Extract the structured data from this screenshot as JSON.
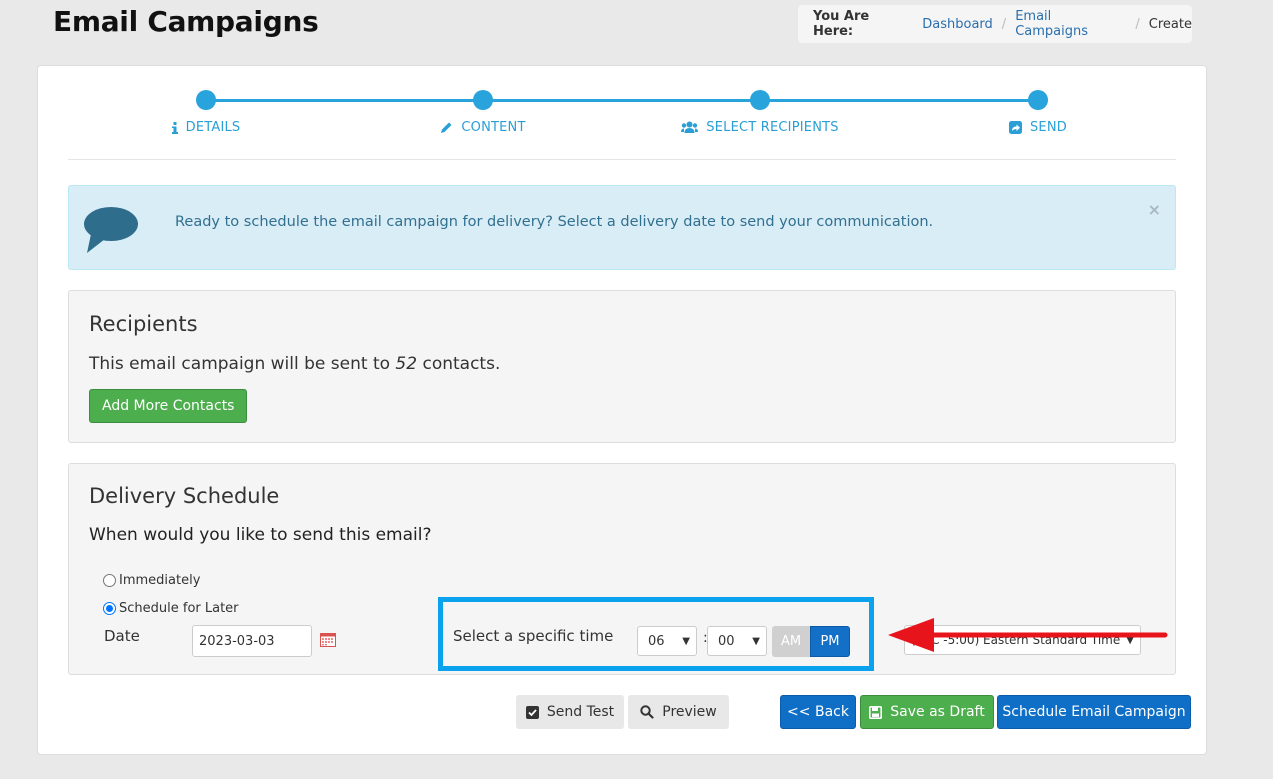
{
  "page": {
    "title": "Email Campaigns"
  },
  "breadcrumb": {
    "lead": "You Are Here:",
    "items": [
      "Dashboard",
      "Email Campaigns"
    ],
    "current": "Create"
  },
  "wizard": {
    "accent": "#29a3dc",
    "steps": [
      {
        "label": "DETAILS",
        "icon": "info-icon"
      },
      {
        "label": "CONTENT",
        "icon": "pencil-icon"
      },
      {
        "label": "SELECT RECIPIENTS",
        "icon": "users-icon"
      },
      {
        "label": "SEND",
        "icon": "share-icon"
      }
    ]
  },
  "alert": {
    "message": "Ready to schedule the email campaign for delivery? Select a delivery date to send your communication.",
    "close": "×"
  },
  "recipients": {
    "title": "Recipients",
    "text_before": "This email campaign will be sent to ",
    "count": "52",
    "text_after": " contacts.",
    "add_button": "Add More Contacts"
  },
  "schedule": {
    "title": "Delivery Schedule",
    "question": "When would you like to send this email?",
    "options": [
      {
        "label": "Immediately",
        "selected": false
      },
      {
        "label": "Schedule for Later",
        "selected": true
      }
    ],
    "date_label": "Date",
    "date_value": "2023-03-03",
    "time_label": "Select a specific time",
    "hour": "06",
    "minute": "00",
    "colon": ":",
    "am": "AM",
    "pm": "PM",
    "period_selected": "PM",
    "timezone": "(UTC -5:00) Eastern Standard Time"
  },
  "footer": {
    "send_test": "Send Test",
    "preview": "Preview",
    "back": "<< Back",
    "save_draft": "Save as Draft",
    "schedule": "Schedule Email Campaign"
  },
  "colors": {
    "annotation_arrow": "#e8141c",
    "highlight_box": "#0aa2ef",
    "primary": "#0f6fc6",
    "success": "#4cae4c"
  }
}
